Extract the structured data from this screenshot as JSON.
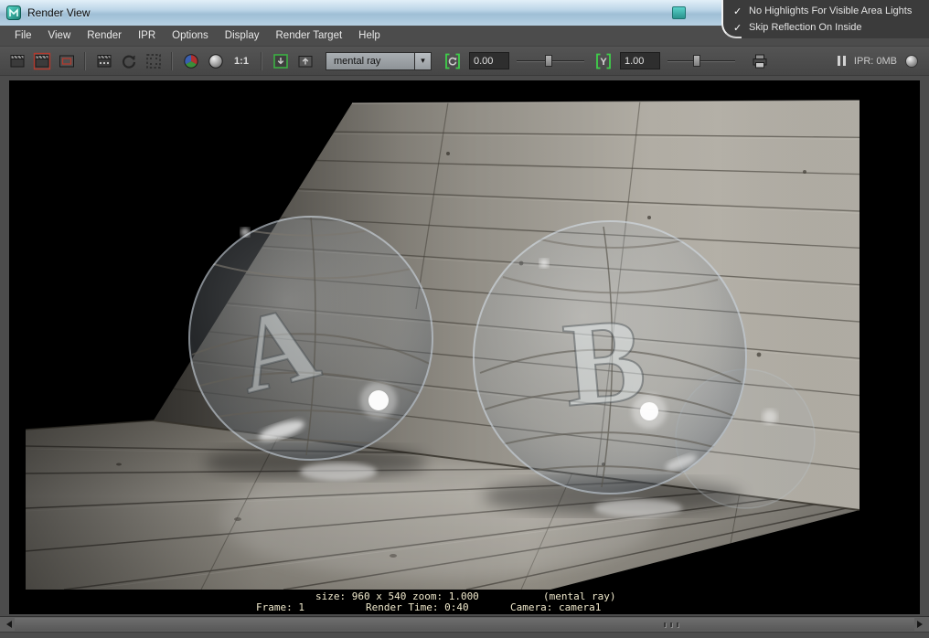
{
  "window": {
    "title": "Render View"
  },
  "overlay_menu": {
    "items": [
      {
        "label": "No Highlights For Visible Area Lights",
        "checked": true
      },
      {
        "label": "Skip Reflection On Inside",
        "checked": true
      }
    ]
  },
  "menubar": {
    "items": [
      "File",
      "View",
      "Render",
      "IPR",
      "Options",
      "Display",
      "Render Target",
      "Help"
    ]
  },
  "toolbar": {
    "renderer": "mental ray",
    "one_to_one_label": "1:1",
    "exposure_value": "0.00",
    "gamma_value": "1.00",
    "gamma_icon_letter": "Y",
    "ipr_status": "IPR: 0MB",
    "icons": [
      "render-current-frame-icon",
      "redo-previous-render-icon",
      "snapshot-icon",
      "ipr-render-icon",
      "refresh-ipr-icon",
      "ipr-update-region-icon",
      "rgb-channels-icon",
      "alpha-channel-icon",
      "real-size-label",
      "keep-image-icon",
      "remove-image-icon",
      "chevron-down-icon",
      "exposure-icon",
      "gamma-icon",
      "print-icon",
      "pause-ipr-icon",
      "ipr-indicator-sphere-icon"
    ]
  },
  "viewport": {
    "scene": {
      "description": "mental ray render of two glass spheres with letters inside, on weathered wood planks floor against leaning wood plank wall",
      "sphere_a_label": "A",
      "sphere_b_label": "B"
    }
  },
  "statusbar": {
    "size_zoom": "size: 960 x 540 zoom: 1.000",
    "renderer": "(mental ray)",
    "frame": "Frame: 1",
    "render_time": "Render Time: 0:40",
    "camera": "Camera: camera1"
  },
  "colors": {
    "titlebar_blue": "#b7d0e2",
    "panel_gray": "#4c4c4c",
    "accent_green": "#3cb043",
    "status_text": "#efe8cb",
    "canvas_black": "#000000"
  }
}
